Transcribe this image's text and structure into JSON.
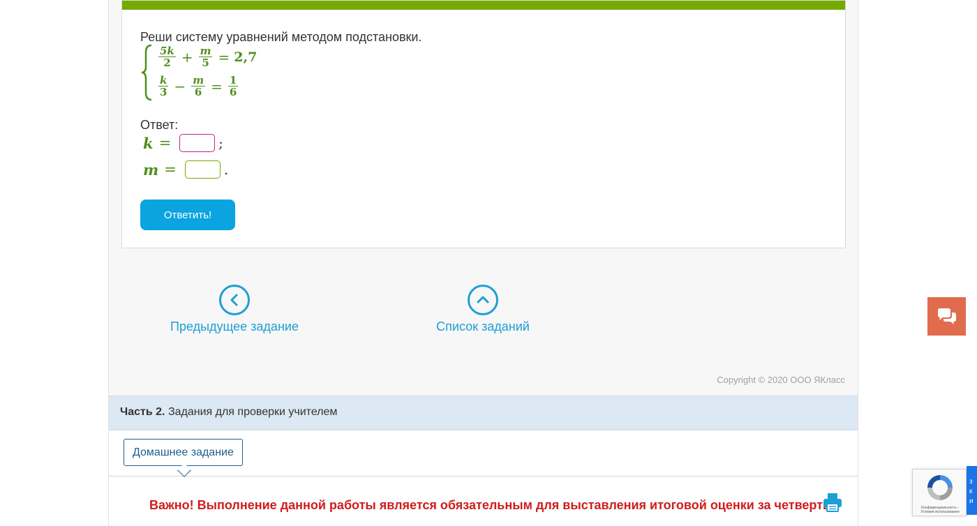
{
  "task": {
    "question": "Реши систему уравнений методом подстановки.",
    "equations": {
      "eq1": {
        "t1_num": "5k",
        "t1_den": "2",
        "op": "+",
        "t2_num": "m",
        "t2_den": "5",
        "eq": "=",
        "rhs": "2,7"
      },
      "eq2": {
        "t1_num": "k",
        "t1_den": "3",
        "op": "−",
        "t2_num": "m",
        "t2_den": "6",
        "eq": "=",
        "rhs_num": "1",
        "rhs_den": "6"
      }
    },
    "answer_label": "Ответ:",
    "k_var": "k",
    "m_var": "m",
    "equals": "=",
    "k_sep": ";",
    "m_sep": ".",
    "k_value": "",
    "m_value": "",
    "submit_label": "Ответить!"
  },
  "nav": {
    "prev_label": "Предыдущее задание",
    "list_label": "Список заданий",
    "prev_icon": "chevron-left-circle-icon",
    "list_icon": "chevron-up-circle-icon"
  },
  "copyright": "Copyright © 2020 ООО ЯКласс",
  "part2": {
    "bold": "Часть 2.",
    "text": "Задания для проверки учителем"
  },
  "tabs": {
    "homework_label": "Домашнее задание"
  },
  "notice": "Важно! Выполнение данной работы является обязательным для выставления итоговой оценки за четверть.",
  "recaptcha": {
    "text": "Конфиденциальность - Условия использования",
    "side_letters": "з к и"
  },
  "colors": {
    "green_header": "#76a900",
    "math_green": "#4e8f1c",
    "button_blue": "#0aa4e0",
    "link_blue": "#1c9fd3",
    "notice_red": "#d01d1d",
    "chat_orange": "#e06b4d",
    "part2_bg": "#dce8f3"
  }
}
